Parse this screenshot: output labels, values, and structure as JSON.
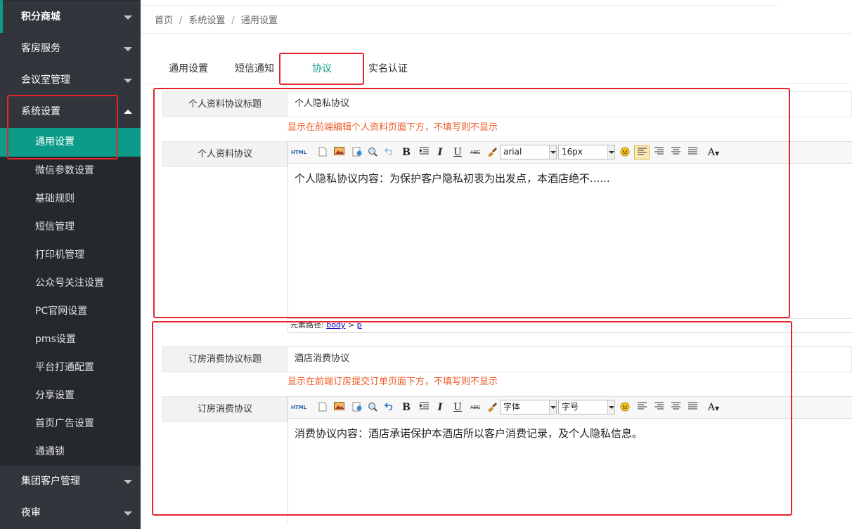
{
  "sidebar": {
    "groups": [
      {
        "label": "积分商城"
      },
      {
        "label": "客房服务"
      },
      {
        "label": "会议室管理"
      },
      {
        "label": "系统设置"
      },
      {
        "label": "集团客户管理"
      },
      {
        "label": "夜审"
      }
    ],
    "items": [
      {
        "label": "通用设置",
        "active": true
      },
      {
        "label": "微信参数设置"
      },
      {
        "label": "基础规则"
      },
      {
        "label": "短信管理"
      },
      {
        "label": "打印机管理"
      },
      {
        "label": "公众号关注设置"
      },
      {
        "label": "PC官网设置"
      },
      {
        "label": "pms设置"
      },
      {
        "label": "平台打通配置"
      },
      {
        "label": "分享设置"
      },
      {
        "label": "首页广告设置"
      },
      {
        "label": "通通锁"
      }
    ]
  },
  "breadcrumb": {
    "items": [
      "首页",
      "系统设置",
      "通用设置"
    ],
    "separator": "/"
  },
  "tabs": [
    {
      "label": "通用设置"
    },
    {
      "label": "短信通知"
    },
    {
      "label": "协议",
      "active": true
    },
    {
      "label": "实名认证"
    }
  ],
  "section1": {
    "title_label": "个人资料协议标题",
    "title_value": "个人隐私协议",
    "hint": "显示在前端编辑个人资料页面下方，不填写则不显示",
    "content_label": "个人资料协议",
    "font_family": "arial",
    "font_size": "16px",
    "content": "个人隐私协议内容：为保护客户隐私初衷为出发点，本酒店绝不......",
    "path_label": "元素路径:",
    "path_body": "body",
    "path_gt": ">",
    "path_p": "p"
  },
  "section2": {
    "title_label": "订房消费协议标题",
    "title_value": "酒店消费协议",
    "hint": "显示在前端订房提交订单页面下方，不填写则不显示",
    "content_label": "订房消费协议",
    "font_family": "字体",
    "font_size": "字号",
    "content": "消费协议内容：酒店承诺保护本酒店所以客户消费记录，及个人隐私信息。"
  },
  "toolbar": {
    "html": "HTML",
    "bold": "B",
    "italic": "I",
    "underline": "U",
    "strike": "ABC",
    "forecolor": "A"
  },
  "colors": {
    "accent": "#0c9b88",
    "highlight": "#e5242c",
    "hint": "#ee5a25",
    "sidebar": "#2a2d32"
  }
}
